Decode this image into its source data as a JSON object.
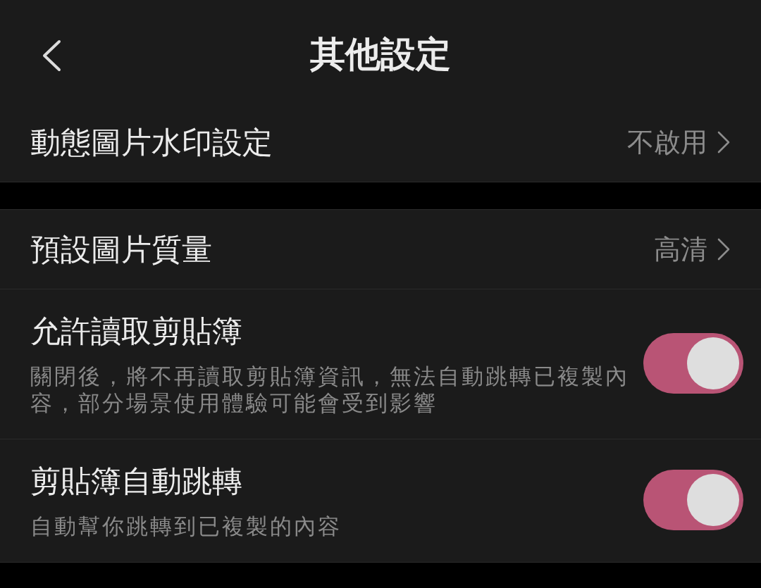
{
  "header": {
    "title": "其他設定"
  },
  "groups": [
    {
      "items": [
        {
          "kind": "link",
          "label": "動態圖片水印設定",
          "value": "不啟用"
        }
      ]
    },
    {
      "items": [
        {
          "kind": "link",
          "label": "預設圖片質量",
          "value": "高清"
        },
        {
          "kind": "toggle",
          "label": "允許讀取剪貼簿",
          "description": "關閉後，將不再讀取剪貼簿資訊，無法自動跳轉已複製內容，部分場景使用體驗可能會受到影響",
          "on": true
        },
        {
          "kind": "toggle",
          "label": "剪貼簿自動跳轉",
          "description": "自動幫你跳轉到已複製的內容",
          "on": true
        }
      ]
    }
  ]
}
